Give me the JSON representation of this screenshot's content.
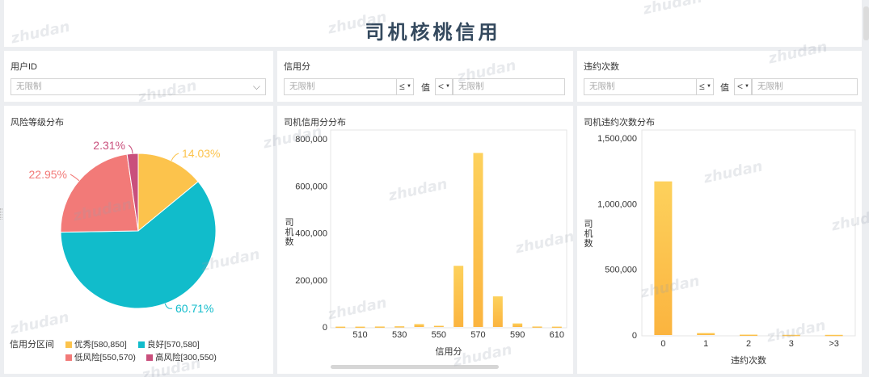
{
  "page": {
    "title": "司机核桃信用",
    "watermark": "zhudan"
  },
  "filters": {
    "user_id": {
      "label": "用户ID",
      "value": "无限制"
    },
    "credit": {
      "label": "信用分",
      "min_placeholder": "无限制",
      "op_left": "≤",
      "value_word": "值",
      "op_right": "<",
      "max_placeholder": "无限制"
    },
    "violation": {
      "label": "违约次数",
      "min_placeholder": "无限制",
      "op_left": "≤",
      "value_word": "值",
      "op_right": "<",
      "max_placeholder": "无限制"
    }
  },
  "pie_panel": {
    "title": "风险等级分布",
    "legend_title": "信用分区间",
    "legend": [
      {
        "label": "优秀[580,850]",
        "color": "#fcc34c"
      },
      {
        "label": "良好[570,580]",
        "color": "#11bccb"
      },
      {
        "label": "低风险[550,570)",
        "color": "#f27a78"
      },
      {
        "label": "高风险[300,550)",
        "color": "#c94f7c"
      }
    ]
  },
  "score_panel": {
    "title": "司机信用分分布"
  },
  "violation_panel": {
    "title": "司机违约次数分布"
  },
  "chart_data": [
    {
      "id": "pie_risk",
      "type": "pie",
      "slices": [
        {
          "name": "优秀[580,850]",
          "value": 14.03,
          "label": "14.03%",
          "color": "#fcc34c"
        },
        {
          "name": "良好[570,580]",
          "value": 60.71,
          "label": "60.71%",
          "color": "#11bccb"
        },
        {
          "name": "低风险[550,570)",
          "value": 22.95,
          "label": "22.95%",
          "color": "#f27a78"
        },
        {
          "name": "高风险[300,550)",
          "value": 2.31,
          "label": "2.31%",
          "color": "#c94f7c"
        }
      ]
    },
    {
      "id": "bar_score",
      "type": "bar",
      "x": [
        500,
        510,
        520,
        530,
        540,
        550,
        560,
        570,
        580,
        590,
        600,
        610
      ],
      "values": [
        1500,
        1500,
        2000,
        3000,
        12000,
        5000,
        260000,
        740000,
        130000,
        15000,
        2000,
        1500
      ],
      "xticks": [
        "510",
        "530",
        "550",
        "570",
        "590",
        "610"
      ],
      "yticks": [
        "0",
        "200,000",
        "400,000",
        "600,000",
        "800,000"
      ],
      "ylim": [
        0,
        800000
      ],
      "xlabel": "信用分",
      "ylabel": "司机数",
      "color": "#fcc34c"
    },
    {
      "id": "bar_violation",
      "type": "bar",
      "categories": [
        "0",
        "1",
        "2",
        "3",
        ">3"
      ],
      "values": [
        1170000,
        15000,
        3000,
        1500,
        1500
      ],
      "yticks": [
        "0",
        "500,000",
        "1,000,000",
        "1,500,000"
      ],
      "ylim": [
        0,
        1500000
      ],
      "xlabel": "违约次数",
      "ylabel": "司机数",
      "color": "#fcc34c"
    }
  ]
}
